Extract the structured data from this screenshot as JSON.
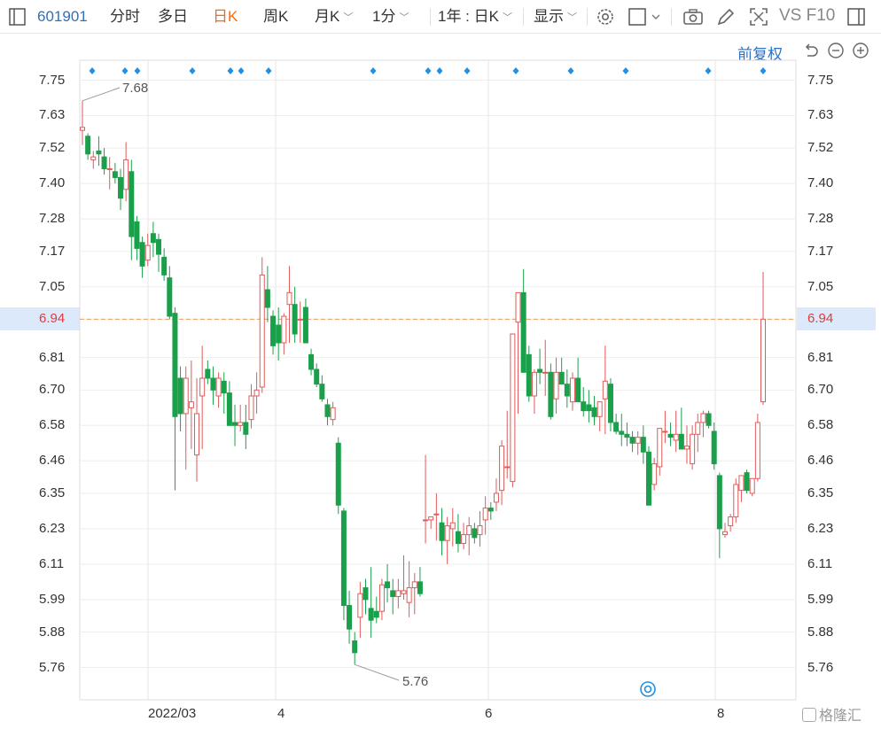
{
  "toolbar": {
    "code": "601901",
    "items": [
      "分时",
      "多日",
      "日K",
      "周K",
      "月K",
      "1分",
      "1年 : 日K",
      "显示"
    ],
    "active": "日K",
    "right_text": "VS F10",
    "icons": [
      "sidebar-toggle-icon",
      "settings-gear-icon",
      "color-box-icon",
      "camera-icon",
      "pen-icon",
      "fullscreen-icon",
      "window-icon"
    ]
  },
  "controls": {
    "adjust_label": "前复权",
    "icons": [
      "undo-icon",
      "zoom-out-icon",
      "zoom-in-icon"
    ]
  },
  "watermark": "格隆汇",
  "chart_data": {
    "type": "candlestick",
    "title": "",
    "ylim": [
      5.7,
      7.78
    ],
    "y_ticks": [
      7.75,
      7.63,
      7.52,
      7.4,
      7.28,
      7.17,
      7.05,
      6.94,
      6.81,
      6.7,
      6.58,
      6.46,
      6.35,
      6.23,
      6.11,
      5.99,
      5.88,
      5.76
    ],
    "last_price": 6.94,
    "x_labels": [
      "2022/03",
      "4",
      "6",
      "8"
    ],
    "annotations": {
      "high_label": "7.68",
      "low_label": "5.76"
    },
    "marker_count": 16,
    "colors": {
      "up": "#e05a5a",
      "down": "#1aa04a",
      "accent": "#2f6fc0",
      "highlight": "#e03c3c",
      "marker": "#1e90e6"
    },
    "candles": [
      [
        7.58,
        7.68,
        7.53,
        7.59
      ],
      [
        7.56,
        7.57,
        7.48,
        7.5
      ],
      [
        7.48,
        7.51,
        7.45,
        7.49
      ],
      [
        7.51,
        7.56,
        7.46,
        7.5
      ],
      [
        7.49,
        7.52,
        7.43,
        7.45
      ],
      [
        7.45,
        7.49,
        7.38,
        7.45
      ],
      [
        7.44,
        7.47,
        7.4,
        7.42
      ],
      [
        7.42,
        7.45,
        7.31,
        7.35
      ],
      [
        7.38,
        7.54,
        7.34,
        7.48
      ],
      [
        7.44,
        7.48,
        7.14,
        7.22
      ],
      [
        7.27,
        7.29,
        7.14,
        7.18
      ],
      [
        7.2,
        7.22,
        7.08,
        7.12
      ],
      [
        7.14,
        7.23,
        7.12,
        7.19
      ],
      [
        7.23,
        7.27,
        7.15,
        7.2
      ],
      [
        7.21,
        7.23,
        7.1,
        7.16
      ],
      [
        7.15,
        7.18,
        7.07,
        7.09
      ],
      [
        7.08,
        7.12,
        6.94,
        6.95
      ],
      [
        6.96,
        6.98,
        6.36,
        6.61
      ],
      [
        6.74,
        6.78,
        6.56,
        6.62
      ],
      [
        6.62,
        6.78,
        6.43,
        6.74
      ],
      [
        6.64,
        6.8,
        6.5,
        6.66
      ],
      [
        6.48,
        6.74,
        6.39,
        6.62
      ],
      [
        6.68,
        6.85,
        6.5,
        6.74
      ],
      [
        6.77,
        6.8,
        6.72,
        6.74
      ],
      [
        6.74,
        6.78,
        6.65,
        6.7
      ],
      [
        6.68,
        6.76,
        6.64,
        6.74
      ],
      [
        6.73,
        6.76,
        6.62,
        6.69
      ],
      [
        6.69,
        6.73,
        6.58,
        6.58
      ],
      [
        6.59,
        6.65,
        6.51,
        6.58
      ],
      [
        6.58,
        6.65,
        6.56,
        6.59
      ],
      [
        6.59,
        6.65,
        6.5,
        6.55
      ],
      [
        6.6,
        6.72,
        6.57,
        6.68
      ],
      [
        6.68,
        6.76,
        6.62,
        6.7
      ],
      [
        6.71,
        7.15,
        6.69,
        7.09
      ],
      [
        7.04,
        7.12,
        6.93,
        6.98
      ],
      [
        6.95,
        6.97,
        6.82,
        6.85
      ],
      [
        6.92,
        6.98,
        6.8,
        6.86
      ],
      [
        6.86,
        6.96,
        6.82,
        6.95
      ],
      [
        6.99,
        7.12,
        6.86,
        7.03
      ],
      [
        6.99,
        7.05,
        6.86,
        6.89
      ],
      [
        6.94,
        7.0,
        6.86,
        6.94
      ],
      [
        6.98,
        7.01,
        6.88,
        6.86
      ],
      [
        6.82,
        6.84,
        6.75,
        6.77
      ],
      [
        6.77,
        6.79,
        6.71,
        6.72
      ],
      [
        6.72,
        6.75,
        6.66,
        6.67
      ],
      [
        6.65,
        6.67,
        6.58,
        6.61
      ],
      [
        6.6,
        6.66,
        6.58,
        6.64
      ],
      [
        6.52,
        6.54,
        6.28,
        6.31
      ],
      [
        6.29,
        6.3,
        5.92,
        5.97
      ],
      [
        5.97,
        6.02,
        5.84,
        5.89
      ],
      [
        5.85,
        5.88,
        5.77,
        5.81
      ],
      [
        5.93,
        6.05,
        5.86,
        6.01
      ],
      [
        6.03,
        6.06,
        5.94,
        5.99
      ],
      [
        5.96,
        6.1,
        5.86,
        5.92
      ],
      [
        5.95,
        6.0,
        5.91,
        5.93
      ],
      [
        5.95,
        6.06,
        5.92,
        6.04
      ],
      [
        6.05,
        6.11,
        5.98,
        6.03
      ],
      [
        6.02,
        6.06,
        5.94,
        6.0
      ],
      [
        6.0,
        6.06,
        5.96,
        6.02
      ],
      [
        6.01,
        6.14,
        5.99,
        6.02
      ],
      [
        5.98,
        6.12,
        5.93,
        6.03
      ],
      [
        6.03,
        6.08,
        5.94,
        6.05
      ],
      [
        6.05,
        6.1,
        6.0,
        6.01
      ],
      [
        6.26,
        6.48,
        6.18,
        6.26
      ],
      [
        6.26,
        6.27,
        6.23,
        6.27
      ],
      [
        6.28,
        6.35,
        6.19,
        6.28
      ],
      [
        6.25,
        6.3,
        6.14,
        6.19
      ],
      [
        6.19,
        6.27,
        6.11,
        6.24
      ],
      [
        6.23,
        6.3,
        6.17,
        6.25
      ],
      [
        6.22,
        6.28,
        6.15,
        6.18
      ],
      [
        6.18,
        6.25,
        6.16,
        6.21
      ],
      [
        6.21,
        6.27,
        6.14,
        6.24
      ],
      [
        6.23,
        6.25,
        6.18,
        6.2
      ],
      [
        6.21,
        6.29,
        6.17,
        6.24
      ],
      [
        6.26,
        6.34,
        6.21,
        6.3
      ],
      [
        6.3,
        6.32,
        6.26,
        6.29
      ],
      [
        6.32,
        6.4,
        6.29,
        6.35
      ],
      [
        6.36,
        6.53,
        6.31,
        6.51
      ],
      [
        6.44,
        6.63,
        6.4,
        6.44
      ],
      [
        6.39,
        6.89,
        6.37,
        6.89
      ],
      [
        6.93,
        7.03,
        6.62,
        7.03
      ],
      [
        7.03,
        7.11,
        6.76,
        6.76
      ],
      [
        6.82,
        6.85,
        6.66,
        6.68
      ],
      [
        6.68,
        6.77,
        6.62,
        6.76
      ],
      [
        6.77,
        6.84,
        6.72,
        6.76
      ],
      [
        6.76,
        6.87,
        6.68,
        6.76
      ],
      [
        6.76,
        6.79,
        6.6,
        6.61
      ],
      [
        6.67,
        6.81,
        6.62,
        6.76
      ],
      [
        6.76,
        6.81,
        6.72,
        6.72
      ],
      [
        6.72,
        6.77,
        6.64,
        6.68
      ],
      [
        6.66,
        6.76,
        6.63,
        6.74
      ],
      [
        6.74,
        6.81,
        6.68,
        6.66
      ],
      [
        6.66,
        6.71,
        6.61,
        6.63
      ],
      [
        6.65,
        6.7,
        6.59,
        6.63
      ],
      [
        6.64,
        6.68,
        6.58,
        6.61
      ],
      [
        6.61,
        6.66,
        6.56,
        6.66
      ],
      [
        6.67,
        6.85,
        6.55,
        6.73
      ],
      [
        6.72,
        6.74,
        6.56,
        6.59
      ],
      [
        6.59,
        6.62,
        6.55,
        6.56
      ],
      [
        6.56,
        6.62,
        6.51,
        6.55
      ],
      [
        6.55,
        6.59,
        6.51,
        6.54
      ],
      [
        6.54,
        6.56,
        6.49,
        6.52
      ],
      [
        6.52,
        6.56,
        6.48,
        6.54
      ],
      [
        6.54,
        6.58,
        6.45,
        6.49
      ],
      [
        6.49,
        6.51,
        6.31,
        6.31
      ],
      [
        6.38,
        6.47,
        6.36,
        6.45
      ],
      [
        6.44,
        6.53,
        6.41,
        6.57
      ],
      [
        6.56,
        6.63,
        6.52,
        6.56
      ],
      [
        6.55,
        6.59,
        6.51,
        6.54
      ],
      [
        6.53,
        6.63,
        6.49,
        6.55
      ],
      [
        6.55,
        6.64,
        6.51,
        6.5
      ],
      [
        6.5,
        6.58,
        6.45,
        6.51
      ],
      [
        6.45,
        6.58,
        6.43,
        6.55
      ],
      [
        6.55,
        6.62,
        6.49,
        6.59
      ],
      [
        6.59,
        6.63,
        6.54,
        6.62
      ],
      [
        6.62,
        6.63,
        6.57,
        6.58
      ],
      [
        6.56,
        6.59,
        6.43,
        6.45
      ],
      [
        6.41,
        6.42,
        6.13,
        6.23
      ],
      [
        6.21,
        6.25,
        6.2,
        6.22
      ],
      [
        6.24,
        6.28,
        6.22,
        6.27
      ],
      [
        6.27,
        6.4,
        6.25,
        6.38
      ],
      [
        6.36,
        6.4,
        6.32,
        6.41
      ],
      [
        6.42,
        6.43,
        6.35,
        6.36
      ],
      [
        6.35,
        6.4,
        6.34,
        6.4
      ],
      [
        6.4,
        6.62,
        6.39,
        6.59
      ],
      [
        6.66,
        7.1,
        6.65,
        6.94
      ]
    ]
  }
}
